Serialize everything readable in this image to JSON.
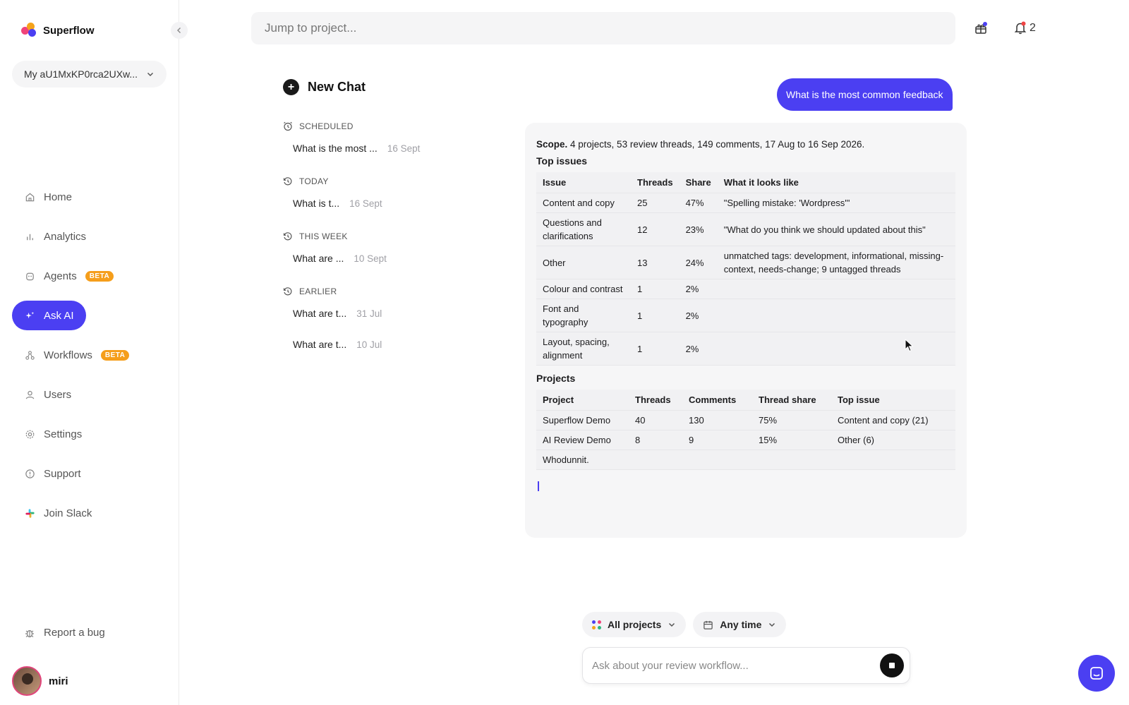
{
  "brand": {
    "name": "Superflow"
  },
  "workspace": {
    "label": "My aU1MxKP0rca2UXw..."
  },
  "sidebar": {
    "items": [
      {
        "label": "Home",
        "icon": "home-icon"
      },
      {
        "label": "Analytics",
        "icon": "bar-chart-icon"
      },
      {
        "label": "Agents",
        "icon": "agent-icon",
        "badge": "BETA"
      },
      {
        "label": "Ask AI",
        "icon": "sparkle-icon",
        "active": true
      },
      {
        "label": "Workflows",
        "icon": "workflow-icon",
        "badge": "BETA"
      },
      {
        "label": "Users",
        "icon": "user-icon"
      },
      {
        "label": "Settings",
        "icon": "gear-icon"
      },
      {
        "label": "Support",
        "icon": "info-icon"
      },
      {
        "label": "Join Slack",
        "icon": "slack-icon"
      }
    ],
    "report_bug": "Report a bug",
    "user_name": "miri"
  },
  "search": {
    "placeholder": "Jump to project..."
  },
  "notifications": {
    "count": "2"
  },
  "history": {
    "new_chat": "New Chat",
    "groups": [
      {
        "label": "SCHEDULED",
        "items": [
          {
            "title": "What is the most ...",
            "date": "16 Sept"
          }
        ]
      },
      {
        "label": "TODAY",
        "items": [
          {
            "title": "What is t...",
            "date": "16 Sept"
          }
        ]
      },
      {
        "label": "THIS WEEK",
        "items": [
          {
            "title": "What are ...",
            "date": "10 Sept"
          }
        ]
      },
      {
        "label": "EARLIER",
        "items": [
          {
            "title": "What are t...",
            "date": "31 Jul"
          },
          {
            "title": "What are t...",
            "date": "10 Jul"
          }
        ]
      }
    ]
  },
  "chat": {
    "user_message": "What is the most common feedback",
    "answer": {
      "scope_label": "Scope.",
      "scope_text": "4 projects, 53 review threads, 149 comments, 17 Aug to 16 Sep 2026.",
      "top_issues_title": "Top issues",
      "issues_headers": [
        "Issue",
        "Threads",
        "Share",
        "What it looks like"
      ],
      "issues_rows": [
        [
          "Content and copy",
          "25",
          "47%",
          "\"Spelling mistake: 'Wordpress'\""
        ],
        [
          "Questions and clarifications",
          "12",
          "23%",
          "\"What do you think we should updated about this\""
        ],
        [
          "Other",
          "13",
          "24%",
          "unmatched tags: development, informational, missing-context, needs-change; 9 untagged threads"
        ],
        [
          "Colour and contrast",
          "1",
          "2%",
          ""
        ],
        [
          "Font and typography",
          "1",
          "2%",
          ""
        ],
        [
          "Layout, spacing, alignment",
          "1",
          "2%",
          ""
        ]
      ],
      "projects_title": "Projects",
      "projects_headers": [
        "Project",
        "Threads",
        "Comments",
        "Thread share",
        "Top issue"
      ],
      "projects_rows": [
        [
          "Superflow Demo",
          "40",
          "130",
          "75%",
          "Content and copy (21)"
        ],
        [
          "AI Review Demo",
          "8",
          "9",
          "15%",
          "Other (6)"
        ],
        [
          "Whodunnit.",
          "",
          "",
          "",
          ""
        ]
      ]
    }
  },
  "filters": {
    "projects": "All projects",
    "time": "Any time"
  },
  "composer": {
    "placeholder": "Ask about your review workflow..."
  },
  "colors": {
    "accent": "#4b3ff2",
    "beta": "#f59e1b"
  }
}
